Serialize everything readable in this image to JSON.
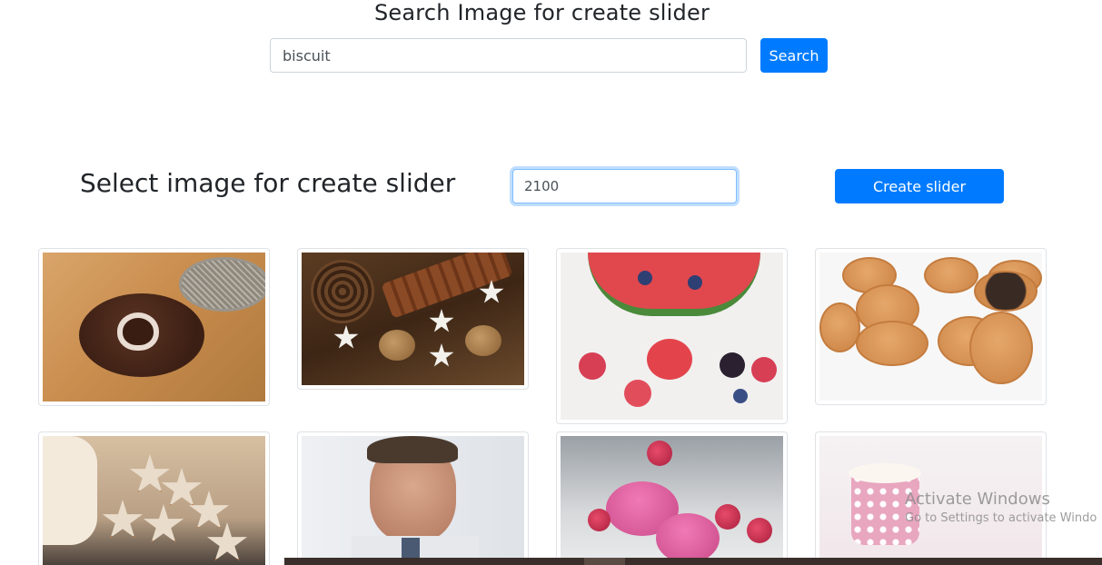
{
  "header": {
    "title": "Search Image for create slider"
  },
  "search": {
    "value": "biscuit",
    "button_label": "Search"
  },
  "slider": {
    "section_title": "Select image for create slider",
    "duration_value": "2100",
    "create_button_label": "Create slider"
  },
  "gallery": {
    "images": [
      {
        "subject": "cookie-with-heart"
      },
      {
        "subject": "cinnamon-and-star-cookies"
      },
      {
        "subject": "watermelon-and-berries"
      },
      {
        "subject": "smiley-biscuits"
      },
      {
        "subject": "star-cookies-on-slate"
      },
      {
        "subject": "man-eating-biscuit"
      },
      {
        "subject": "pink-macarons"
      },
      {
        "subject": "pink-polka-dot-cup"
      }
    ]
  },
  "os_watermark": {
    "line1": "Activate Windows",
    "line2": "Go to Settings to activate Windo"
  }
}
